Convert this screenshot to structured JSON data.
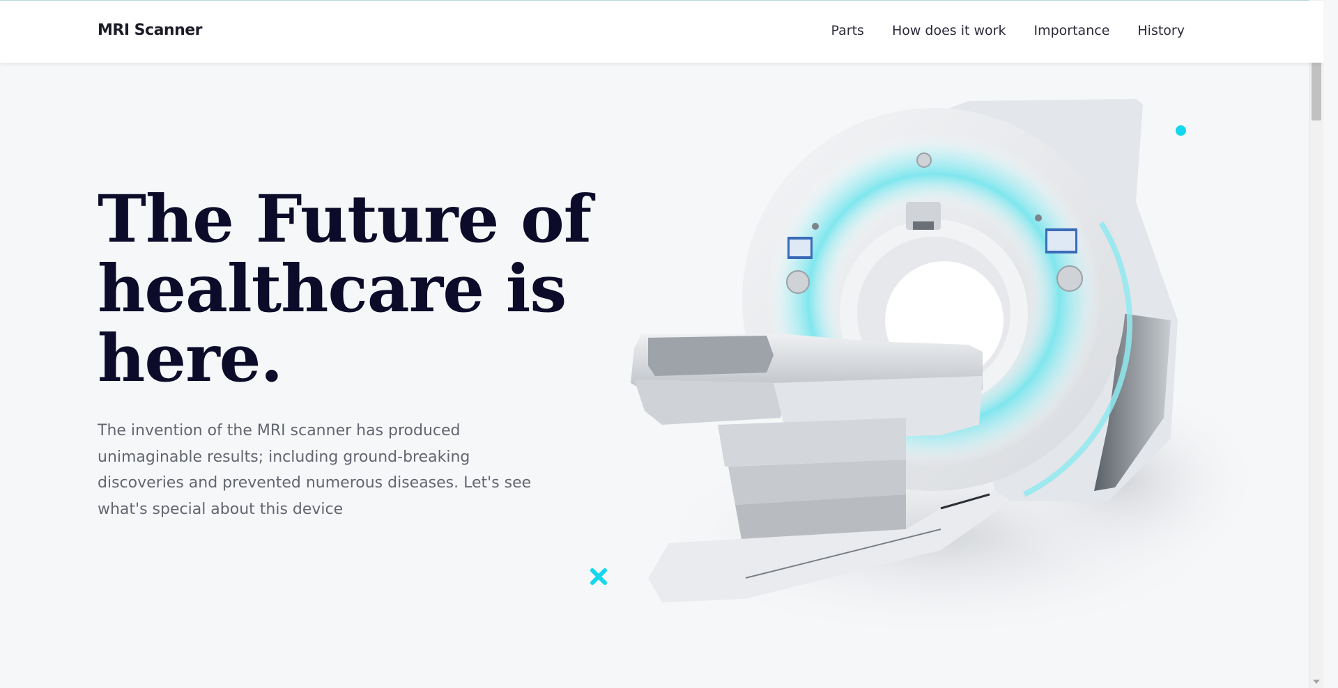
{
  "navbar": {
    "brand": "MRI Scanner",
    "links": [
      "Parts",
      "How does it work",
      "Importance",
      "History"
    ]
  },
  "hero": {
    "headline": "The Future of healthcare is here.",
    "lead": "The invention of the MRI scanner has produced unimaginable results; including ground-breaking discoveries and prevented numerous diseases. Let's see what's special about this device"
  },
  "colors": {
    "accent": "#14d7ee",
    "headline": "#0c0c2a",
    "body_text": "#63656f",
    "background": "#f6f7f9"
  },
  "icons": {
    "decor_dot": "accent-dot",
    "decor_cross": "cross-icon"
  }
}
